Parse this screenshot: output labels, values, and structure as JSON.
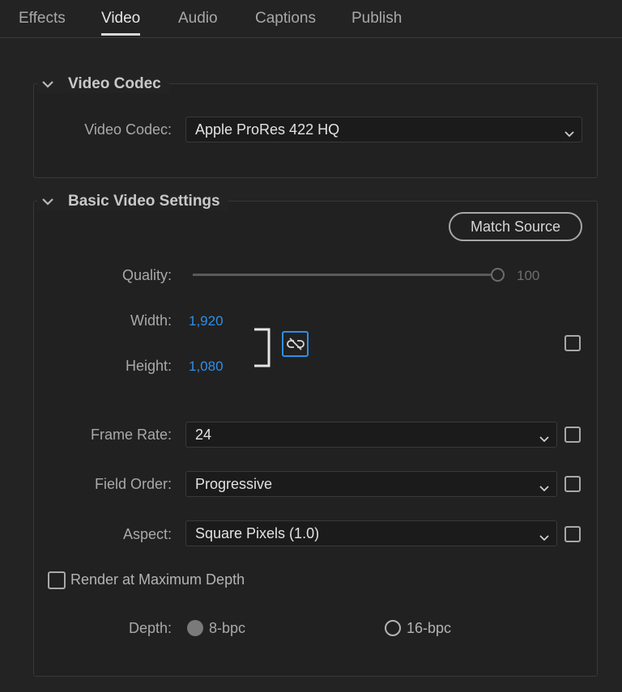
{
  "tabs": [
    {
      "label": "Effects"
    },
    {
      "label": "Video"
    },
    {
      "label": "Audio"
    },
    {
      "label": "Captions"
    },
    {
      "label": "Publish"
    }
  ],
  "active_tab": "Video",
  "video_codec_section": {
    "title": "Video Codec",
    "codec_label": "Video Codec:",
    "codec_value": "Apple ProRes 422 HQ"
  },
  "basic_video_section": {
    "title": "Basic Video Settings",
    "match_source_label": "Match Source",
    "quality_label": "Quality:",
    "quality_value": "100",
    "width_label": "Width:",
    "width_value": "1,920",
    "height_label": "Height:",
    "height_value": "1,080",
    "frame_rate_label": "Frame Rate:",
    "frame_rate_value": "24",
    "field_order_label": "Field Order:",
    "field_order_value": "Progressive",
    "aspect_label": "Aspect:",
    "aspect_value": "Square Pixels (1.0)",
    "render_max_depth_label": "Render at Maximum Depth",
    "depth_label": "Depth:",
    "depth_8_label": "8-bpc",
    "depth_16_label": "16-bpc"
  },
  "colors": {
    "background": "#232323",
    "accent_blue": "#2f8fe8"
  }
}
